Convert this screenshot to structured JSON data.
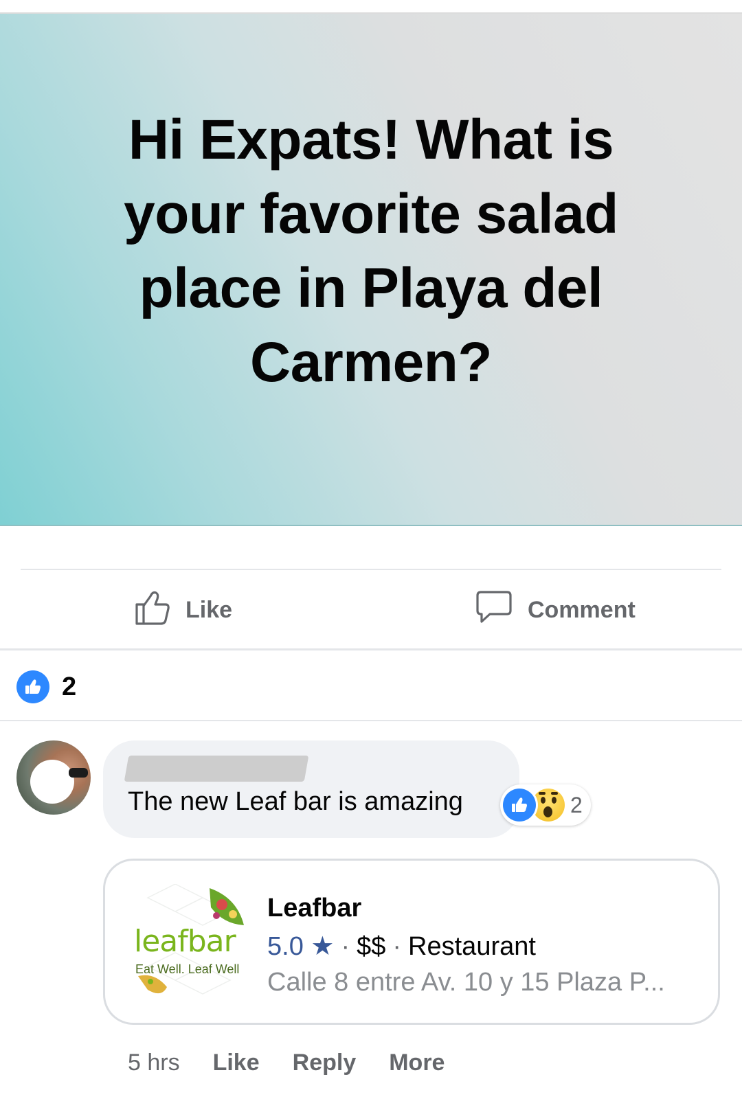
{
  "post": {
    "text": "Hi Expats! What is your favorite salad place in Playa del Carmen?"
  },
  "actions": {
    "like_label": "Like",
    "comment_label": "Comment"
  },
  "reactions": {
    "count": "2"
  },
  "comment": {
    "text": "The new Leaf bar is amazing",
    "reaction_count": "2",
    "link_card": {
      "logo_word": "leafbar",
      "logo_tagline": "Eat Well. Leaf Well",
      "title": "Leafbar",
      "rating": "5.0 ★",
      "price": "$$",
      "category": "Restaurant",
      "address": "Calle 8 entre Av. 10 y 15 Plaza P..."
    },
    "timestamp": "5 hrs",
    "like_label": "Like",
    "reply_label": "Reply",
    "more_label": "More"
  }
}
